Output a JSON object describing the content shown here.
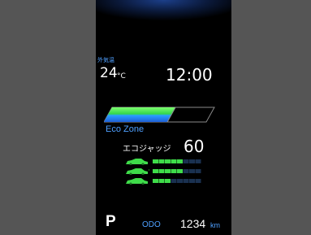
{
  "temperature": {
    "caption": "外気温",
    "value": "24",
    "unit": "°C"
  },
  "clock": "12:00",
  "eco_indicator": {
    "zone_label": "Eco Zone",
    "level": 0.62,
    "judge_label": "エコジャッジ",
    "judge_score": "60"
  },
  "eco_breakdown": [
    {
      "icon": "car-start-icon",
      "filled": 5,
      "total": 8
    },
    {
      "icon": "car-cruise-icon",
      "filled": 5,
      "total": 8
    },
    {
      "icon": "car-stop-icon",
      "filled": 3,
      "total": 8
    }
  ],
  "gear": "P",
  "odometer": {
    "label": "ODO",
    "value": "1234",
    "unit": "km"
  },
  "colors": {
    "accent": "#4fa0ff",
    "eco_green": "#3fdc4a",
    "eco_blue": "#2a7fff",
    "segment_off": "#1a3150"
  }
}
